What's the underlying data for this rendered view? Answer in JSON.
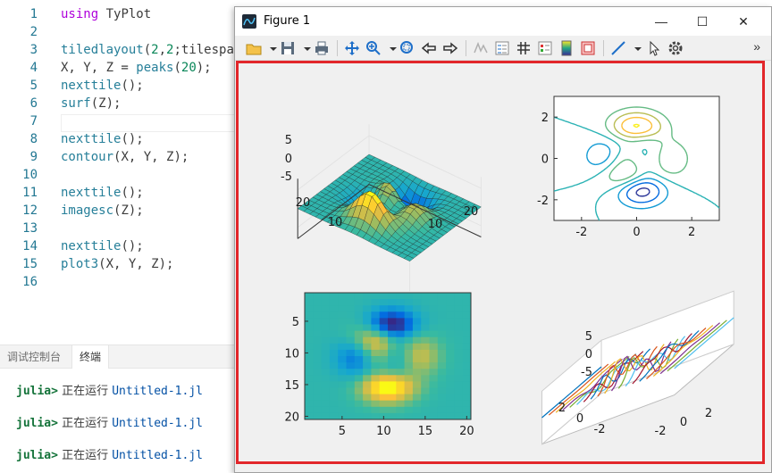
{
  "editor": {
    "lines": [
      {
        "n": "1",
        "parts": [
          {
            "t": "using",
            "c": "kw"
          },
          {
            "t": " TyPlot",
            "c": ""
          }
        ]
      },
      {
        "n": "2",
        "parts": []
      },
      {
        "n": "3",
        "parts": [
          {
            "t": "tiledlayout",
            "c": "fn"
          },
          {
            "t": "(",
            "c": ""
          },
          {
            "t": "2",
            "c": "num"
          },
          {
            "t": ",",
            "c": ""
          },
          {
            "t": "2",
            "c": "num"
          },
          {
            "t": ";tilespac",
            "c": ""
          }
        ]
      },
      {
        "n": "4",
        "parts": [
          {
            "t": "X, Y, Z = ",
            "c": ""
          },
          {
            "t": "peaks",
            "c": "fn"
          },
          {
            "t": "(",
            "c": ""
          },
          {
            "t": "20",
            "c": "num"
          },
          {
            "t": ");",
            "c": ""
          }
        ]
      },
      {
        "n": "5",
        "parts": [
          {
            "t": "nexttile",
            "c": "fn"
          },
          {
            "t": "();",
            "c": ""
          }
        ]
      },
      {
        "n": "6",
        "parts": [
          {
            "t": "surf",
            "c": "fn"
          },
          {
            "t": "(Z);",
            "c": ""
          }
        ]
      },
      {
        "n": "7",
        "parts": []
      },
      {
        "n": "8",
        "parts": [
          {
            "t": "nexttile",
            "c": "fn"
          },
          {
            "t": "();",
            "c": ""
          }
        ]
      },
      {
        "n": "9",
        "parts": [
          {
            "t": "contour",
            "c": "fn"
          },
          {
            "t": "(X, Y, Z);",
            "c": ""
          }
        ]
      },
      {
        "n": "10",
        "parts": []
      },
      {
        "n": "11",
        "parts": [
          {
            "t": "nexttile",
            "c": "fn"
          },
          {
            "t": "();",
            "c": ""
          }
        ]
      },
      {
        "n": "12",
        "parts": [
          {
            "t": "imagesc",
            "c": "fn"
          },
          {
            "t": "(Z);",
            "c": ""
          }
        ]
      },
      {
        "n": "13",
        "parts": []
      },
      {
        "n": "14",
        "parts": [
          {
            "t": "nexttile",
            "c": "fn"
          },
          {
            "t": "();",
            "c": ""
          }
        ]
      },
      {
        "n": "15",
        "parts": [
          {
            "t": "plot3",
            "c": "fn"
          },
          {
            "t": "(X, Y, Z);",
            "c": ""
          }
        ]
      },
      {
        "n": "16",
        "parts": []
      }
    ]
  },
  "panel": {
    "tabs": [
      "调试控制台",
      "终端"
    ],
    "active_tab": "终端",
    "repl": [
      {
        "prompt": "julia>",
        "msg": " 正在运行 ",
        "file": "Untitled-1.jl"
      },
      {
        "prompt": "julia>",
        "msg": " 正在运行 ",
        "file": "Untitled-1.jl"
      },
      {
        "prompt": "julia>",
        "msg": " 正在运行 ",
        "file": "Untitled-1.jl"
      }
    ]
  },
  "figure": {
    "title": "Figure 1",
    "buttons": {
      "minimize": "—",
      "maximize": "☐",
      "close": "✕"
    },
    "toolbar_icons": [
      "open-icon",
      "save-icon",
      "print-icon",
      "pan-icon",
      "zoom-in-icon",
      "zoom-fit-icon",
      "back-icon",
      "forward-icon",
      "data-cursor-icon",
      "legend-icon",
      "grid-icon",
      "property-icon",
      "colorbar-icon",
      "frame-icon",
      "line-tool-icon",
      "select-icon",
      "settings-icon"
    ],
    "toolbar_more": "»",
    "highlight_color": "#e2262a"
  },
  "chart_data": [
    {
      "type": "surface",
      "z_ticks": [
        "5",
        "0",
        "-5"
      ],
      "x_ticks": [
        "10",
        "20"
      ],
      "y_ticks": [
        "20",
        "10"
      ]
    },
    {
      "type": "contour",
      "x_ticks": [
        "-2",
        "0",
        "2"
      ],
      "y_ticks": [
        "2",
        "0",
        "-2"
      ]
    },
    {
      "type": "heatmap",
      "x_ticks": [
        "5",
        "10",
        "15",
        "20"
      ],
      "y_ticks": [
        "5",
        "10",
        "15",
        "20"
      ]
    },
    {
      "type": "line3d",
      "z_ticks": [
        "5",
        "0",
        "-5"
      ],
      "x_ticks": [
        "-2",
        "0",
        "2"
      ],
      "y_ticks": [
        "2",
        "0",
        "-2"
      ]
    }
  ]
}
